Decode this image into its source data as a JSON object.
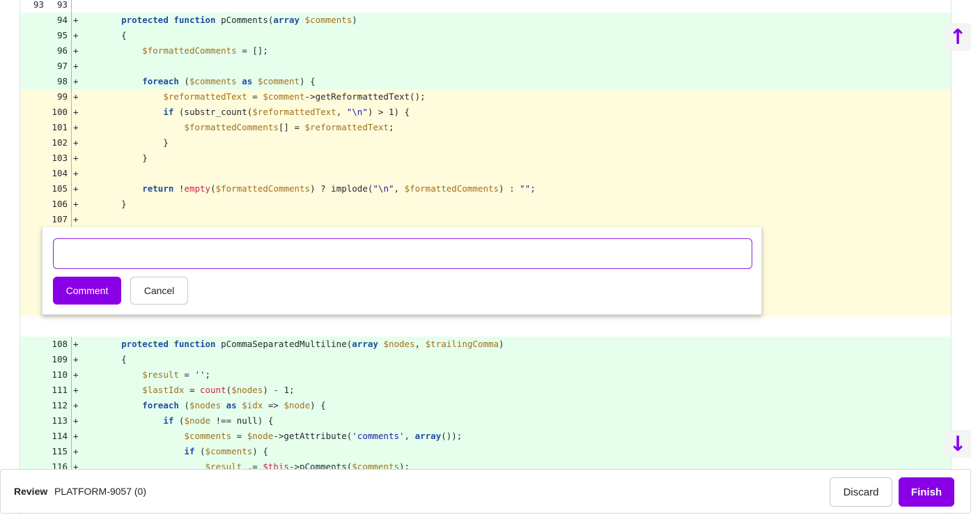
{
  "diff": {
    "context_row": {
      "old": "93",
      "new": "93",
      "marker": "",
      "code": ""
    },
    "rows_top": [
      {
        "new": "94",
        "marker": "+",
        "type": "added",
        "tokens": [
          [
            "    ",
            ""
          ],
          [
            "protected",
            "kw"
          ],
          [
            " ",
            ""
          ],
          [
            "function",
            "kw"
          ],
          [
            " pComments(",
            ""
          ],
          [
            "array",
            "kw"
          ],
          [
            " ",
            ""
          ],
          [
            "$comments",
            "var"
          ],
          [
            ")",
            ""
          ]
        ]
      },
      {
        "new": "95",
        "marker": "+",
        "type": "added",
        "tokens": [
          [
            "    {",
            ""
          ]
        ]
      },
      {
        "new": "96",
        "marker": "+",
        "type": "added",
        "tokens": [
          [
            "        ",
            ""
          ],
          [
            "$formattedComments",
            "var"
          ],
          [
            " = [];",
            ""
          ]
        ]
      },
      {
        "new": "97",
        "marker": "+",
        "type": "added",
        "tokens": []
      },
      {
        "new": "98",
        "marker": "+",
        "type": "added",
        "tokens": [
          [
            "        ",
            ""
          ],
          [
            "foreach",
            "kw"
          ],
          [
            " (",
            ""
          ],
          [
            "$comments",
            "var"
          ],
          [
            " ",
            ""
          ],
          [
            "as",
            "kw"
          ],
          [
            " ",
            ""
          ],
          [
            "$comment",
            "var"
          ],
          [
            ") {",
            ""
          ]
        ]
      },
      {
        "new": "99",
        "marker": "+",
        "type": "hl",
        "tokens": [
          [
            "            ",
            ""
          ],
          [
            "$reformattedText",
            "var"
          ],
          [
            " = ",
            ""
          ],
          [
            "$comment",
            "var"
          ],
          [
            "->getReformattedText();",
            ""
          ]
        ]
      },
      {
        "new": "100",
        "marker": "+",
        "type": "hl",
        "tokens": [
          [
            "            ",
            ""
          ],
          [
            "if",
            "kw"
          ],
          [
            " (substr_count(",
            ""
          ],
          [
            "$reformattedText",
            "var"
          ],
          [
            ", ",
            ""
          ],
          [
            "\"\\n\"",
            "str"
          ],
          [
            ") > 1) {",
            ""
          ]
        ]
      },
      {
        "new": "101",
        "marker": "+",
        "type": "hl",
        "tokens": [
          [
            "                ",
            ""
          ],
          [
            "$formattedComments",
            "var"
          ],
          [
            "[] = ",
            ""
          ],
          [
            "$reformattedText",
            "var"
          ],
          [
            ";",
            ""
          ]
        ]
      },
      {
        "new": "102",
        "marker": "+",
        "type": "hl",
        "tokens": [
          [
            "            }",
            ""
          ]
        ]
      },
      {
        "new": "103",
        "marker": "+",
        "type": "hl",
        "tokens": [
          [
            "        }",
            ""
          ]
        ]
      },
      {
        "new": "104",
        "marker": "+",
        "type": "hl",
        "tokens": []
      },
      {
        "new": "105",
        "marker": "+",
        "type": "hl",
        "tokens": [
          [
            "        ",
            ""
          ],
          [
            "return",
            "kw"
          ],
          [
            " !",
            ""
          ],
          [
            "empty",
            "fn"
          ],
          [
            "(",
            ""
          ],
          [
            "$formattedComments",
            "var"
          ],
          [
            ") ? implode(",
            ""
          ],
          [
            "\"\\n\"",
            "str"
          ],
          [
            ", ",
            ""
          ],
          [
            "$formattedComments",
            "var"
          ],
          [
            ") : ",
            ""
          ],
          [
            "\"\"",
            "str"
          ],
          [
            ";",
            ""
          ]
        ]
      },
      {
        "new": "106",
        "marker": "+",
        "type": "hl",
        "tokens": [
          [
            "    }",
            ""
          ]
        ]
      },
      {
        "new": "107",
        "marker": "+",
        "type": "hl",
        "tokens": []
      }
    ],
    "rows_bottom": [
      {
        "new": "108",
        "marker": "+",
        "type": "added",
        "tokens": [
          [
            "    ",
            ""
          ],
          [
            "protected",
            "kw"
          ],
          [
            " ",
            ""
          ],
          [
            "function",
            "kw"
          ],
          [
            " pCommaSeparatedMultiline(",
            ""
          ],
          [
            "array",
            "kw"
          ],
          [
            " ",
            ""
          ],
          [
            "$nodes",
            "var"
          ],
          [
            ", ",
            ""
          ],
          [
            "$trailingComma",
            "var"
          ],
          [
            ")",
            ""
          ]
        ]
      },
      {
        "new": "109",
        "marker": "+",
        "type": "added",
        "tokens": [
          [
            "    {",
            ""
          ]
        ]
      },
      {
        "new": "110",
        "marker": "+",
        "type": "added",
        "tokens": [
          [
            "        ",
            ""
          ],
          [
            "$result",
            "var"
          ],
          [
            " = ",
            ""
          ],
          [
            "''",
            "str"
          ],
          [
            ";",
            ""
          ]
        ]
      },
      {
        "new": "111",
        "marker": "+",
        "type": "added",
        "tokens": [
          [
            "        ",
            ""
          ],
          [
            "$lastIdx",
            "var"
          ],
          [
            " = ",
            ""
          ],
          [
            "count",
            "fn"
          ],
          [
            "(",
            ""
          ],
          [
            "$nodes",
            "var"
          ],
          [
            ") - 1;",
            ""
          ]
        ]
      },
      {
        "new": "112",
        "marker": "+",
        "type": "added",
        "tokens": [
          [
            "        ",
            ""
          ],
          [
            "foreach",
            "kw"
          ],
          [
            " (",
            ""
          ],
          [
            "$nodes",
            "var"
          ],
          [
            " ",
            ""
          ],
          [
            "as",
            "kw"
          ],
          [
            " ",
            ""
          ],
          [
            "$idx",
            "var"
          ],
          [
            " => ",
            ""
          ],
          [
            "$node",
            "var"
          ],
          [
            ") {",
            ""
          ]
        ]
      },
      {
        "new": "113",
        "marker": "+",
        "type": "added",
        "tokens": [
          [
            "            ",
            ""
          ],
          [
            "if",
            "kw"
          ],
          [
            " (",
            ""
          ],
          [
            "$node",
            "var"
          ],
          [
            " !== null) {",
            ""
          ]
        ]
      },
      {
        "new": "114",
        "marker": "+",
        "type": "added",
        "tokens": [
          [
            "                ",
            ""
          ],
          [
            "$comments",
            "var"
          ],
          [
            " = ",
            ""
          ],
          [
            "$node",
            "var"
          ],
          [
            "->getAttribute(",
            ""
          ],
          [
            "'comments'",
            "str"
          ],
          [
            ", ",
            ""
          ],
          [
            "array",
            "kw"
          ],
          [
            "());",
            ""
          ]
        ]
      },
      {
        "new": "115",
        "marker": "+",
        "type": "added",
        "tokens": [
          [
            "                ",
            ""
          ],
          [
            "if",
            "kw"
          ],
          [
            " (",
            ""
          ],
          [
            "$comments",
            "var"
          ],
          [
            ") {",
            ""
          ]
        ]
      },
      {
        "new": "116",
        "marker": "+",
        "type": "added",
        "tokens": [
          [
            "                    ",
            ""
          ],
          [
            "$result",
            "var"
          ],
          [
            " .= ",
            ""
          ],
          [
            "$this",
            "fn"
          ],
          [
            "->pComments(",
            ""
          ],
          [
            "$comments",
            "var"
          ],
          [
            ");",
            ""
          ]
        ]
      }
    ]
  },
  "comment_form": {
    "input_value": "",
    "input_placeholder": "",
    "comment_label": "Comment",
    "cancel_label": "Cancel"
  },
  "scroll": {
    "up_icon": "arrow-up-icon",
    "down_icon": "arrow-down-icon"
  },
  "review_bar": {
    "label": "Review",
    "id": "PLATFORM-9057 (0)",
    "discard_label": "Discard",
    "finish_label": "Finish"
  },
  "colors": {
    "accent": "#8a00e6",
    "added_bg": "#e6ffed",
    "highlight_bg": "#fffbdd"
  }
}
